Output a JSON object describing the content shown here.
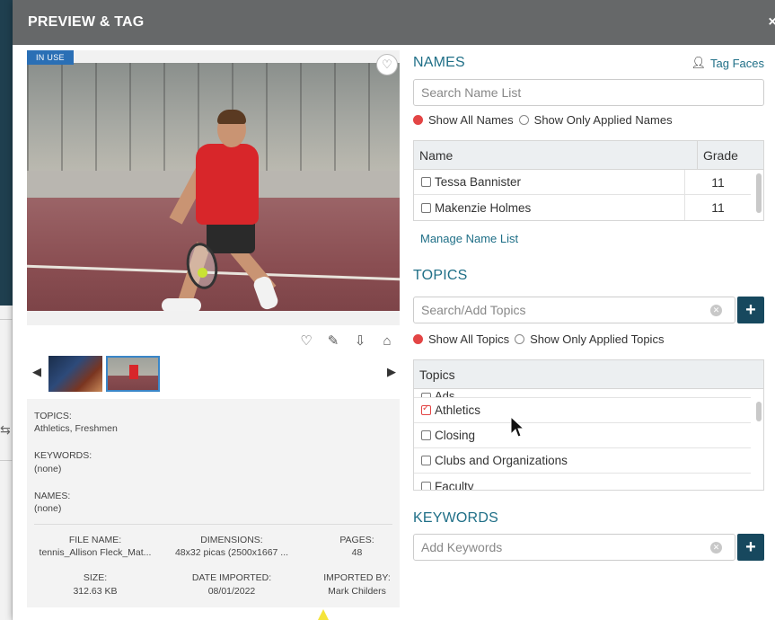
{
  "modal": {
    "title": "PREVIEW & TAG",
    "close_label": "×"
  },
  "preview": {
    "badge": "IN USE",
    "actions": [
      "heart-icon",
      "edit-icon",
      "download-icon",
      "tag-icon"
    ]
  },
  "thumbnails": [
    {
      "name": "thumbnail-1",
      "selected": false
    },
    {
      "name": "thumbnail-2",
      "selected": true
    }
  ],
  "meta": {
    "topics_label": "TOPICS:",
    "topics_value": "Athletics, Freshmen",
    "keywords_label": "KEYWORDS:",
    "keywords_value": "(none)",
    "names_label": "NAMES:",
    "names_value": "(none)",
    "file_name_label": "FILE NAME:",
    "file_name_value": "tennis_Allison Fleck_Mat...",
    "dimensions_label": "DIMENSIONS:",
    "dimensions_value": "48x32 picas (2500x1667 ...",
    "pages_label": "PAGES:",
    "pages_value": "48",
    "size_label": "SIZE:",
    "size_value": "312.63 KB",
    "date_imported_label": "DATE IMPORTED:",
    "date_imported_value": "08/01/2022",
    "imported_by_label": "IMPORTED BY:",
    "imported_by_value": "Mark Childers"
  },
  "names": {
    "title": "NAMES",
    "tag_faces": "Tag Faces",
    "search_placeholder": "Search Name List",
    "show_all": "Show All Names",
    "show_applied": "Show Only Applied Names",
    "col_name": "Name",
    "col_grade": "Grade",
    "rows": [
      {
        "name": "Tessa Bannister",
        "grade": "11"
      },
      {
        "name": "Makenzie Holmes",
        "grade": "11"
      }
    ],
    "manage_link": "Manage Name List"
  },
  "topics": {
    "title": "TOPICS",
    "search_placeholder": "Search/Add Topics",
    "show_all": "Show All Topics",
    "show_applied": "Show Only Applied Topics",
    "col_topics": "Topics",
    "cut_top": "Ads",
    "rows": [
      {
        "label": "Athletics",
        "checked": true
      },
      {
        "label": "Closing",
        "checked": false
      },
      {
        "label": "Clubs and Organizations",
        "checked": false
      }
    ],
    "cut_bottom": "Faculty"
  },
  "keywords": {
    "title": "KEYWORDS",
    "placeholder": "Add Keywords"
  },
  "colors": {
    "header": "#666869",
    "accent": "#1f6f87",
    "button": "#17485e",
    "badge": "#2a6fb5",
    "radio_on": "#e34545"
  }
}
